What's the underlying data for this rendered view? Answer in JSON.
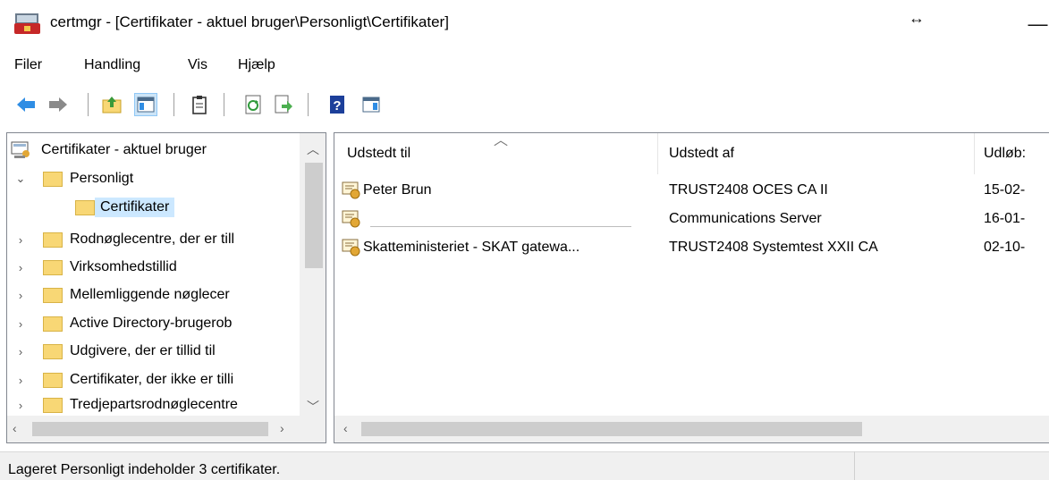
{
  "window": {
    "title": "certmgr - [Certifikater - aktuel bruger\\Personligt\\Certifikater]",
    "resize_glyph": "↔",
    "minimize_glyph": "—"
  },
  "menu": [
    "Filer",
    "Handling",
    "Vis",
    "Hjælp"
  ],
  "toolbar": {
    "icons": [
      "back-arrow-icon",
      "forward-arrow-icon",
      "up-folder-icon",
      "show-hide-tree-icon",
      "properties-icon",
      "refresh-icon",
      "export-list-icon",
      "help-icon",
      "action-pane-icon"
    ]
  },
  "tree": {
    "root": "Certifikater - aktuel bruger",
    "items": [
      {
        "label": "Personligt",
        "expanded": true
      },
      {
        "label": "Certifikater",
        "selected": true
      },
      {
        "label": "Rodnøglecentre, der er till"
      },
      {
        "label": "Virksomhedstillid"
      },
      {
        "label": "Mellemliggende nøglecer"
      },
      {
        "label": "Active Directory-brugerob"
      },
      {
        "label": "Udgivere, der er tillid til"
      },
      {
        "label": "Certifikater, der ikke er tilli"
      },
      {
        "label": "Tredjepartsrodnøglecentre"
      }
    ]
  },
  "list": {
    "columns": [
      "Udstedt til",
      "Udstedt af",
      "Udløb:"
    ],
    "rows": [
      {
        "issued_to": "Peter Brun",
        "issued_by": "TRUST2408 OCES CA II",
        "expires": "15-02-"
      },
      {
        "issued_to": "",
        "issued_by": "Communications Server",
        "expires": "16-01-"
      },
      {
        "issued_to": "Skatteministeriet - SKAT gatewa...",
        "issued_by": "TRUST2408 Systemtest XXII CA",
        "expires": "02-10-"
      }
    ]
  },
  "status": {
    "text": "Lageret Personligt indeholder 3 certifikater."
  },
  "colors": {
    "selection": "#cce8ff",
    "folder": "#f8d775",
    "scrollbar_track": "#f0f0f0",
    "scrollbar_thumb": "#cdcdcd"
  }
}
